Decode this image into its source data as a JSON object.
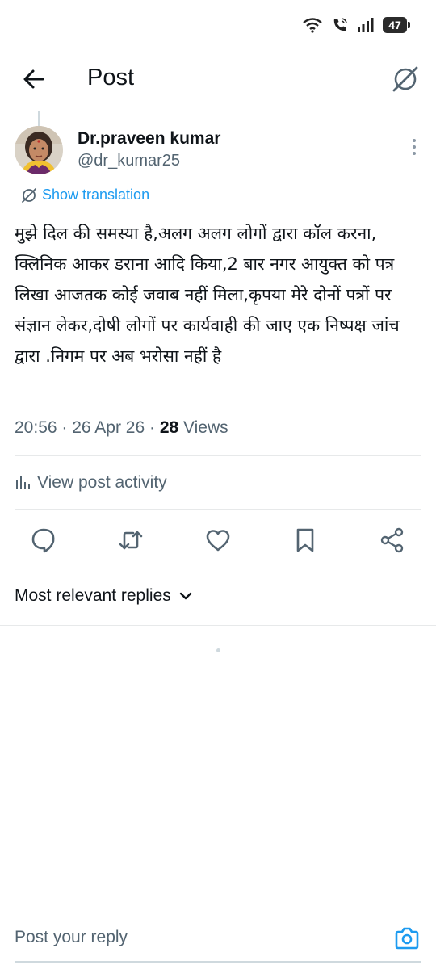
{
  "status_bar": {
    "battery_level": "47"
  },
  "header": {
    "title": "Post"
  },
  "author": {
    "display_name": "Dr.praveen kumar",
    "handle": "@dr_kumar25"
  },
  "translation": {
    "label": "Show translation"
  },
  "post": {
    "text": "मुझे दिल की समस्या है,अलग अलग लोगों द्वारा कॉल करना, क्लिनिक आकर डराना आदि किया,2 बार नगर आयुक्त को पत्र लिखा आजतक कोई जवाब नहीं मिला,कृपया मेरे दोनों पत्रों पर संज्ञान लेकर,दोषी लोगों पर कार्यवाही की जाए एक निष्पक्ष जांच द्वारा .निगम पर अब भरोसा नहीं है",
    "time": "20:56",
    "date": "26 Apr 26",
    "views_count": "28",
    "views_label": "Views"
  },
  "activity": {
    "label": "View post activity"
  },
  "actions": [
    "reply-icon",
    "repost-icon",
    "like-icon",
    "bookmark-icon",
    "share-icon"
  ],
  "replies": {
    "sort_label": "Most relevant replies"
  },
  "reply_bar": {
    "placeholder": "Post your reply"
  },
  "colors": {
    "accent": "#1d9bf0",
    "text": "#0f1419",
    "secondary": "#536471",
    "border": "#e7e9ea"
  }
}
